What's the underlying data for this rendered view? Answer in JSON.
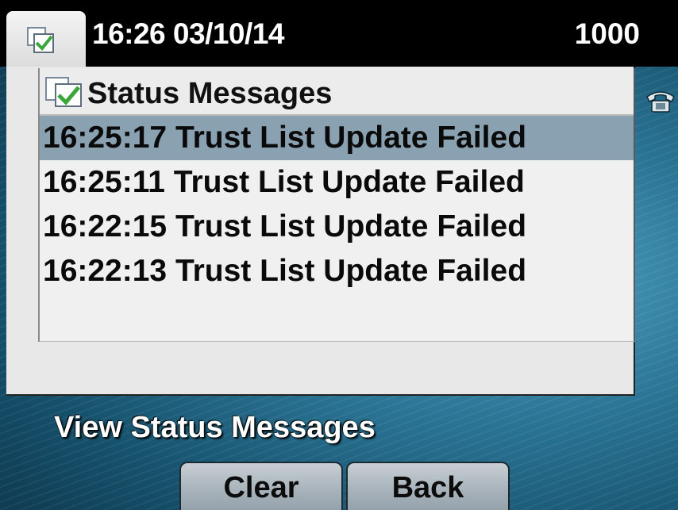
{
  "header": {
    "datetime": "16:26 03/10/14",
    "extension": "1000",
    "tab_icon": "status-check-icon"
  },
  "panel": {
    "title": "Status Messages",
    "title_icon": "status-check-icon",
    "messages": [
      {
        "text": "16:25:17 Trust List Update Failed",
        "selected": true
      },
      {
        "text": "16:25:11 Trust List Update Failed",
        "selected": false
      },
      {
        "text": "16:22:15 Trust List Update Failed",
        "selected": false
      },
      {
        "text": "16:22:13 Trust List Update Failed",
        "selected": false
      }
    ]
  },
  "side_icon": "phone-icon",
  "status_line": "View Status Messages",
  "softkeys": {
    "clear": "Clear",
    "back": "Back"
  },
  "colors": {
    "selection": "#8aa1b2",
    "header": "#000000",
    "check": "#3aa63a"
  }
}
